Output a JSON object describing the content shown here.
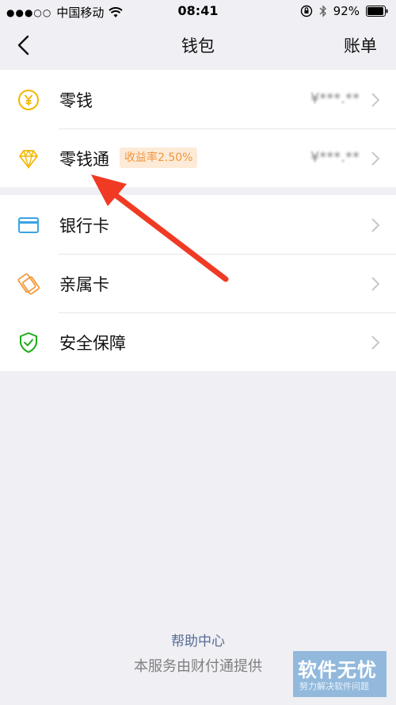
{
  "status_bar": {
    "signal": "●●●○○",
    "carrier": "中国移动",
    "time": "08:41",
    "battery": "92%"
  },
  "nav": {
    "title": "钱包",
    "right_label": "账单"
  },
  "sections": [
    {
      "items": [
        {
          "label": "零钱",
          "icon": "yuan-coin-icon",
          "value": "¥***.**",
          "color": "#f2b600"
        },
        {
          "label": "零钱通",
          "icon": "diamond-icon",
          "badge": "收益率2.50%",
          "value": "¥***.**",
          "color": "#f2b600"
        }
      ]
    },
    {
      "items": [
        {
          "label": "银行卡",
          "icon": "bank-card-icon",
          "color": "#3aa3e3"
        },
        {
          "label": "亲属卡",
          "icon": "family-card-icon",
          "color": "#f39a3d"
        },
        {
          "label": "安全保障",
          "icon": "shield-check-icon",
          "color": "#1aad19"
        }
      ]
    }
  ],
  "footer": {
    "help": "帮助中心",
    "provided_by": "本服务由财付通提供"
  },
  "watermark": {
    "title": "软件无忧",
    "subtitle": "努力解决软件问题"
  },
  "colors": {
    "background": "#efeff4",
    "link": "#576b95",
    "annotation_arrow": "#f03a24"
  }
}
